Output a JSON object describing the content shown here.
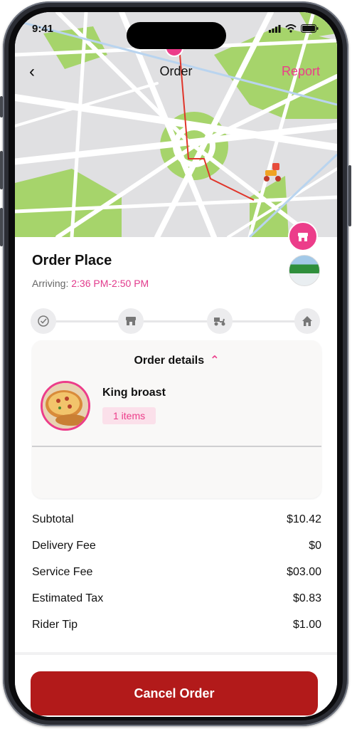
{
  "status_bar": {
    "time": "9:41"
  },
  "nav": {
    "back_icon": "chevron-left-icon",
    "title": "Order",
    "report_label": "Report"
  },
  "order": {
    "title": "Order Place",
    "arriving_label": "Arriving:",
    "arriving_time": "2:36 PM-2:50 PM"
  },
  "progress_steps": [
    "order-placed-icon",
    "store-icon",
    "delivery-scooter-icon",
    "home-icon"
  ],
  "details": {
    "header": "Order details",
    "item_name": "King broast",
    "item_qty": "1 items"
  },
  "summary": [
    {
      "label": "Subtotal",
      "value": "$10.42"
    },
    {
      "label": "Delivery Fee",
      "value": "$0"
    },
    {
      "label": "Service Fee",
      "value": "$03.00"
    },
    {
      "label": "Estimated Tax",
      "value": "$0.83"
    },
    {
      "label": "Rider Tip",
      "value": "$1.00"
    }
  ],
  "cancel_label": "Cancel Order",
  "colors": {
    "accent": "#ec3d8a",
    "cancel": "#b21a1a",
    "park": "#a6d46b",
    "route": "#e0352a"
  }
}
